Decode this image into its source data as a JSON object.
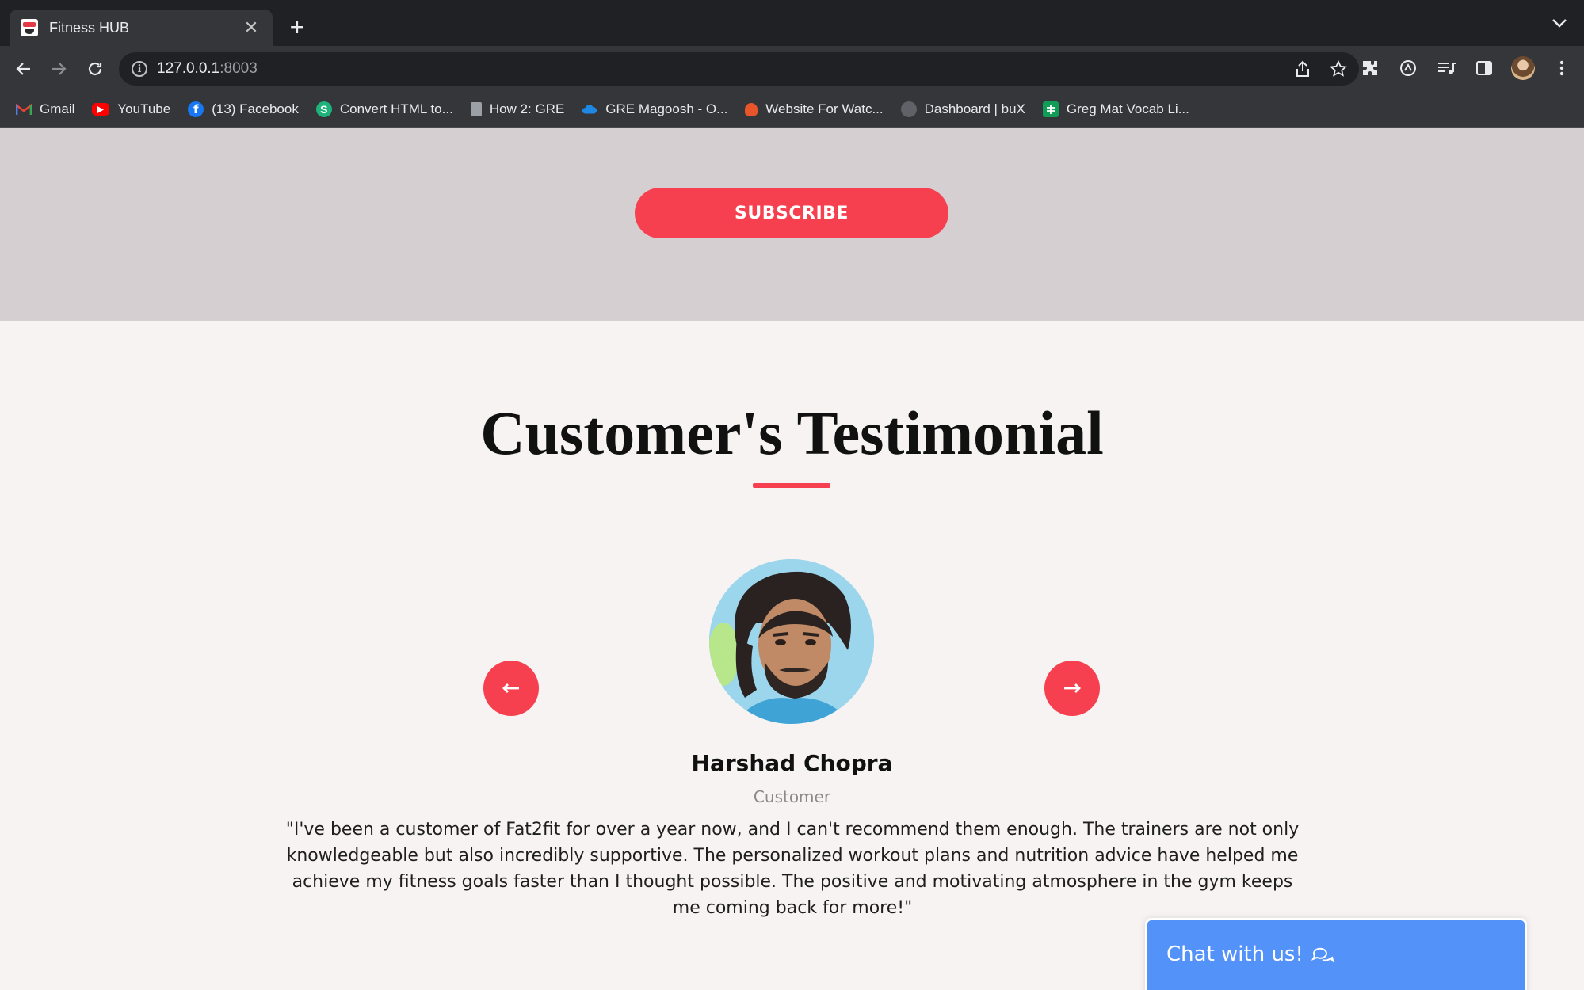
{
  "browser": {
    "tab_title": "Fitness HUB",
    "tab_close": "✕",
    "new_tab": "+",
    "url_host": "127.0.0.1",
    "url_port": ":8003",
    "bookmarks": [
      {
        "label": "Gmail",
        "icon": "gmail-icon"
      },
      {
        "label": "YouTube",
        "icon": "youtube-icon"
      },
      {
        "label": "(13) Facebook",
        "icon": "facebook-icon"
      },
      {
        "label": "Convert HTML to...",
        "icon": "convert-icon"
      },
      {
        "label": "How 2: GRE",
        "icon": "document-icon"
      },
      {
        "label": "GRE Magoosh - O...",
        "icon": "cloud-icon"
      },
      {
        "label": "Website For Watc...",
        "icon": "website-icon"
      },
      {
        "label": "Dashboard | buX",
        "icon": "dashboard-icon"
      },
      {
        "label": "Greg Mat Vocab Li...",
        "icon": "sheets-icon"
      }
    ]
  },
  "subscribe": {
    "button_label": "SUBSCRIBE"
  },
  "testimonial": {
    "title": "Customer's Testimonial",
    "name": "Harshad Chopra",
    "role": "Customer",
    "quote": "\"I've been a customer of Fat2fit for over a year now, and I can't recommend them enough. The trainers are not only knowledgeable but also incredibly supportive. The personalized workout plans and nutrition advice have helped me achieve my fitness goals faster than I thought possible. The positive and motivating atmosphere in the gym keeps me coming back for more!\""
  },
  "chat": {
    "label": "Chat with us!"
  },
  "colors": {
    "accent": "#f6404f",
    "chat": "#5392f8",
    "band": "#d6cfd1",
    "page": "#f7f3f3"
  }
}
